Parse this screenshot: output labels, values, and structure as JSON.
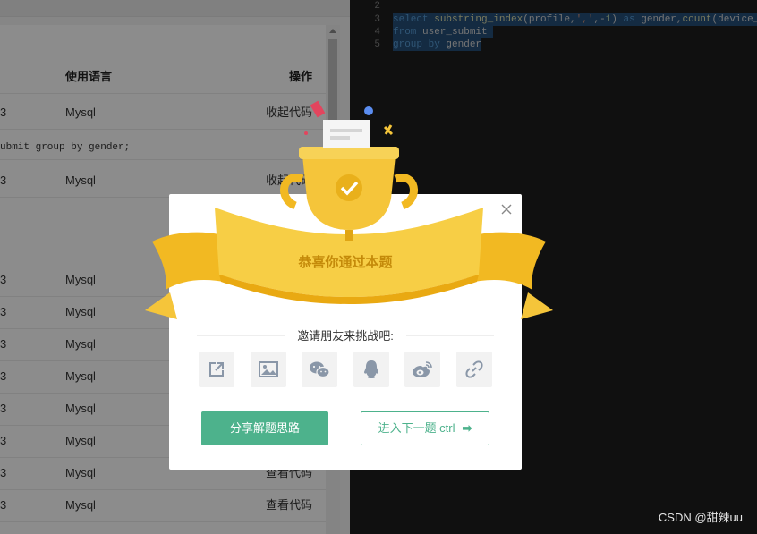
{
  "submissions": {
    "header": {
      "col_language": "使用语言",
      "col_action": "操作"
    },
    "rows": [
      {
        "status": "3",
        "language": "Mysql",
        "action": "收起代码"
      },
      {
        "status": "3",
        "language": "Mysql",
        "action": "收起代码"
      },
      {
        "status": "3",
        "language": "Mysql",
        "action": ""
      },
      {
        "status": "3",
        "language": "Mysql",
        "action": ""
      },
      {
        "status": "3",
        "language": "Mysql",
        "action": ""
      },
      {
        "status": "3",
        "language": "Mysql",
        "action": ""
      },
      {
        "status": "3",
        "language": "Mysql",
        "action": ""
      },
      {
        "status": "3",
        "language": "Mysql",
        "action": ""
      },
      {
        "status": "3",
        "language": "Mysql",
        "action": "查看代码"
      },
      {
        "status": "3",
        "language": "Mysql",
        "action": "查看代码"
      }
    ],
    "expanded_code": "ubmit group by gender;"
  },
  "editor": {
    "line_numbers": [
      "2",
      "3",
      "4",
      "5"
    ],
    "lines": [
      "",
      "select substring_index(profile,',',-1) as gender,count(device_",
      "from user_submit",
      "group by gender"
    ]
  },
  "dialog": {
    "title": "恭喜你通过本题",
    "invite_text": "邀请朋友来挑战吧:",
    "share_targets": [
      "share-icon",
      "image-icon",
      "wechat-icon",
      "qq-icon",
      "weibo-icon",
      "link-icon"
    ],
    "share_button": "分享解题思路",
    "next_button": "进入下一题 ctrl",
    "next_arrow": "➡"
  },
  "watermark": "CSDN @甜辣uu",
  "colors": {
    "accent": "#4db28c",
    "ribbon": "#f5c53a",
    "overlay": "rgba(0,0,0,0.45)"
  }
}
